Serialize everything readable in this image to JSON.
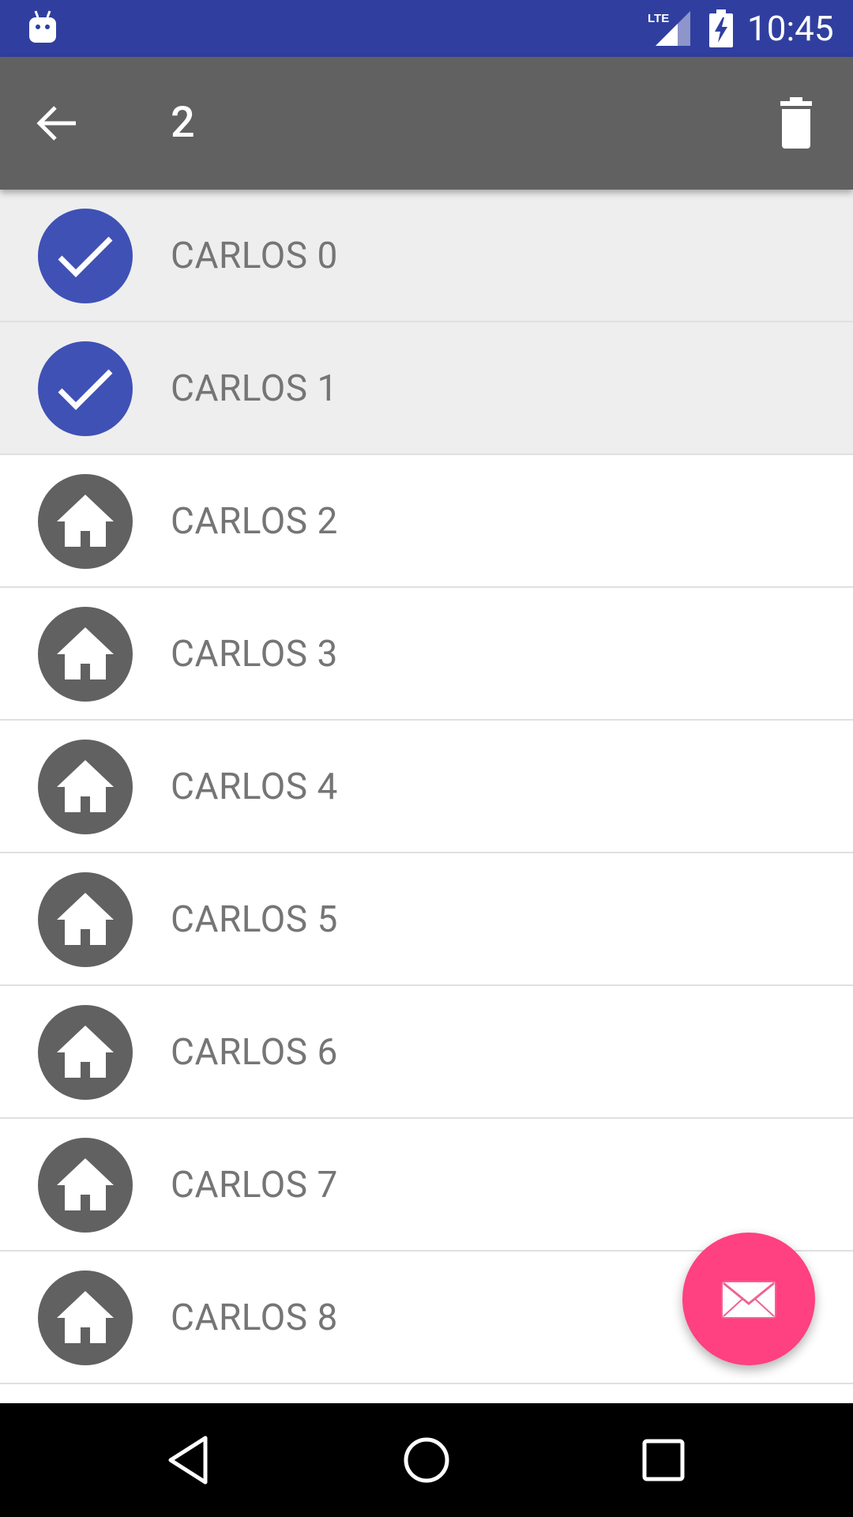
{
  "status_bar": {
    "network_label": "LTE",
    "time": "10:45",
    "icons": [
      "android-debug-icon",
      "lte-signal-icon",
      "battery-charging-icon"
    ]
  },
  "action_bar": {
    "selection_count": "2",
    "back_icon": "arrow-back-icon",
    "delete_icon": "delete-icon",
    "background_color": "#616161"
  },
  "list": {
    "items": [
      {
        "label": "CARLOS 0",
        "selected": true
      },
      {
        "label": "CARLOS 1",
        "selected": true
      },
      {
        "label": "CARLOS 2",
        "selected": false
      },
      {
        "label": "CARLOS 3",
        "selected": false
      },
      {
        "label": "CARLOS 4",
        "selected": false
      },
      {
        "label": "CARLOS 5",
        "selected": false
      },
      {
        "label": "CARLOS 6",
        "selected": false
      },
      {
        "label": "CARLOS 7",
        "selected": false
      },
      {
        "label": "CARLOS 8",
        "selected": false
      }
    ],
    "selected_icon": "check-icon",
    "unselected_icon": "home-icon",
    "selected_color": "#3f51b5",
    "unselected_color": "#616161"
  },
  "fab": {
    "icon": "mail-icon",
    "color": "#ff4081"
  },
  "nav_bar": {
    "icons": [
      "nav-back-icon",
      "nav-home-icon",
      "nav-recents-icon"
    ]
  },
  "colors": {
    "status_bar": "#303f9f",
    "accent": "#ff4081",
    "primary": "#3f51b5"
  }
}
